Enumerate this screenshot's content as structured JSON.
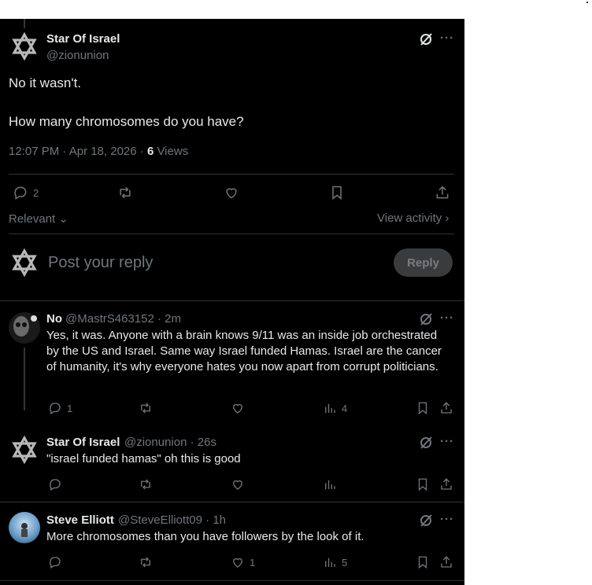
{
  "main": {
    "author_name": "Star Of Israel",
    "author_handle": "@zionunion",
    "line1": "No it wasn't.",
    "line2": "How many chromosomes do you have?",
    "timestamp": "12:07 PM · Apr 18, 2026 · ",
    "views_count": "6",
    "views_label": " Views",
    "reply_count": "2",
    "sort_label": "Relevant",
    "view_activity": "View activity"
  },
  "composer": {
    "placeholder": "Post your reply",
    "button": "Reply"
  },
  "replies": [
    {
      "name": "No",
      "handle": "@MastrS463152 · 2m",
      "text": "Yes, it was. Anyone with a brain knows 9/11 was an inside job orchestrated by the US and Israel. Same way Israel funded Hamas. Israel are the cancer of humanity, it's why everyone hates you now apart from corrupt politicians.",
      "replies": "1",
      "views": "4"
    },
    {
      "name": "Star Of Israel",
      "handle": "@zionunion · 26s",
      "text": "\"israel funded hamas\" oh this is good"
    },
    {
      "name": "Steve Elliott",
      "handle": "@SteveElliott09 · 1h",
      "text": "More chromosomes than you have followers by the look of it.",
      "likes": "1",
      "views": "5"
    }
  ],
  "colors": {
    "background": "#000000",
    "text": "#e7e9ea",
    "muted": "#71767b",
    "divider": "#2f3336"
  }
}
